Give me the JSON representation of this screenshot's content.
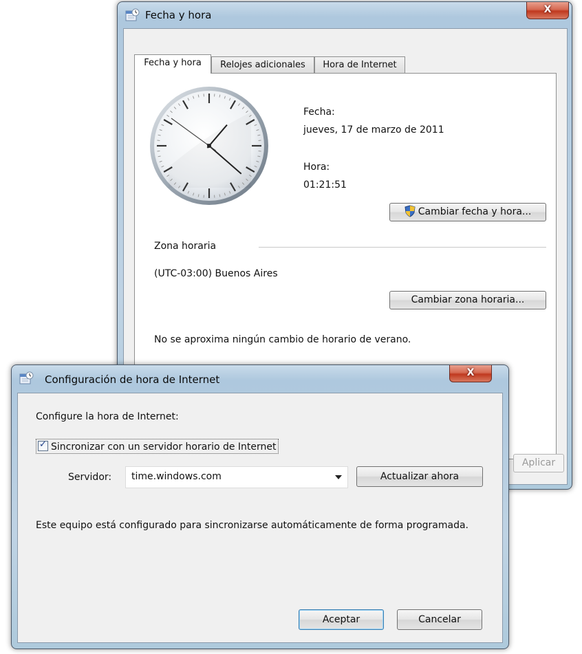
{
  "main_window": {
    "title": "Fecha y hora",
    "close_label": "X",
    "tabs": [
      "Fecha y hora",
      "Relojes adicionales",
      "Hora de Internet"
    ],
    "date_label": "Fecha:",
    "date_value": "jueves, 17 de marzo de 2011",
    "time_label": "Hora:",
    "time_value": "01:21:51",
    "change_datetime_button": "Cambiar fecha y hora...",
    "timezone_section": "Zona horaria",
    "timezone_value": "(UTC-03:00) Buenos Aires",
    "change_timezone_button": "Cambiar zona horaria...",
    "dst_notice": "No se aproxima ningún cambio de horario de verano.",
    "apply_button": "Aplicar"
  },
  "internet_dialog": {
    "title": "Configuración de hora de Internet",
    "close_label": "X",
    "heading": "Configure la hora de Internet:",
    "sync_checkbox_label": "Sincronizar con un servidor horario de Internet",
    "sync_checked": true,
    "server_label": "Servidor:",
    "server_value": "time.windows.com",
    "update_button": "Actualizar ahora",
    "info_text": "Este equipo está configurado para sincronizarse automáticamente de forma programada.",
    "ok_button": "Aceptar",
    "cancel_button": "Cancelar"
  },
  "clock": {
    "hours": 1,
    "minutes": 21,
    "seconds": 51
  },
  "colors": {
    "frame": "#b9d1e6",
    "close": "#c94a30",
    "client": "#f0f0f0"
  }
}
